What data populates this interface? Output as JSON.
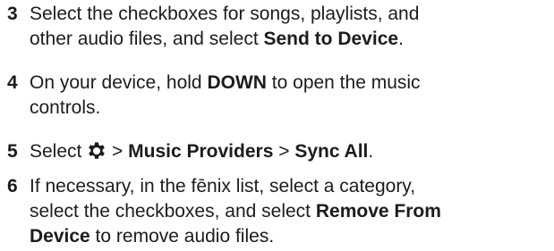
{
  "steps": [
    {
      "number": "3",
      "line1": "Select the checkboxes for songs, playlists, and",
      "line2_text": "other audio files, and select ",
      "line2_bold": "Send to Device",
      "line2_end": "."
    },
    {
      "number": "4",
      "line1_text": "On your device, hold ",
      "line1_bold": "DOWN",
      "line1_end": " to open the music",
      "line2": "controls."
    },
    {
      "number": "5",
      "text_select": "Select ",
      "icon": "gear-icon",
      "sep1": " > ",
      "bold1": "Music Providers",
      "sep2": " > ",
      "bold2": "Sync All",
      "end": "."
    },
    {
      "number": "6",
      "line1": "If necessary, in the fēnix list, select a category,",
      "line2_text": "select the checkboxes, and select ",
      "line2_bold": "Remove From",
      "line3_bold": "Device",
      "line3_end": " to remove audio files."
    }
  ]
}
